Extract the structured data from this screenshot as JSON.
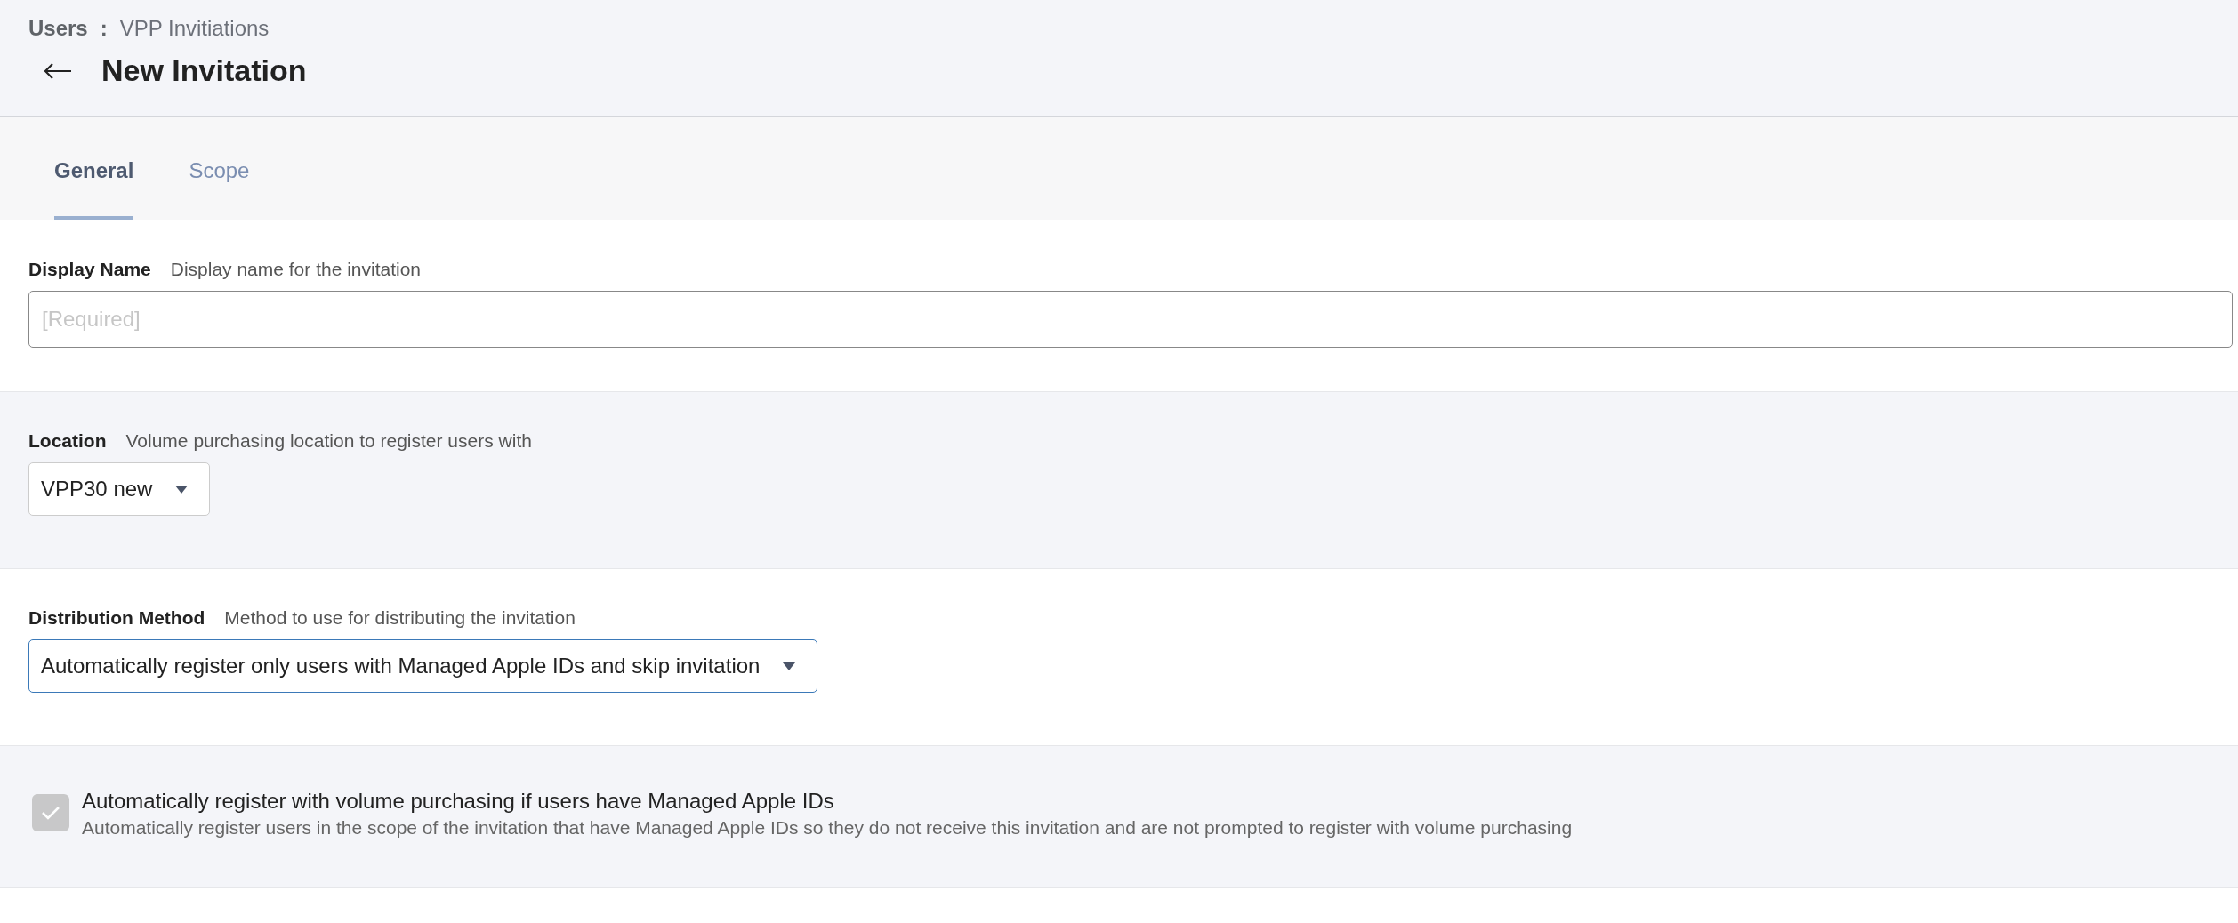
{
  "breadcrumb": {
    "parent": "Users",
    "separator": ":",
    "current": "VPP Invitiations"
  },
  "title": "New Invitation",
  "tabs": [
    {
      "label": "General",
      "selected": true
    },
    {
      "label": "Scope",
      "selected": false
    }
  ],
  "sections": [
    {
      "kind": "text",
      "label": "Display Name",
      "description": "Display name for the invitation",
      "placeholder": "[Required]"
    },
    {
      "kind": "select",
      "label": "Location",
      "description": "Volume purchasing location to register users with",
      "value": "VPP30 new",
      "focused": false
    },
    {
      "kind": "select",
      "label": "Distribution Method",
      "description": "Method to use for distributing the invitation",
      "value": "Automatically register only users with Managed Apple IDs and skip invitation",
      "focused": true
    },
    {
      "kind": "checkbox",
      "label": "Automatically register with volume purchasing if users have Managed Apple IDs",
      "description": "Automatically register users in the scope of the invitation that have Managed Apple IDs so they do not receive this invitation and are not prompted to register with volume purchasing",
      "checked": true,
      "disabled": true
    }
  ]
}
